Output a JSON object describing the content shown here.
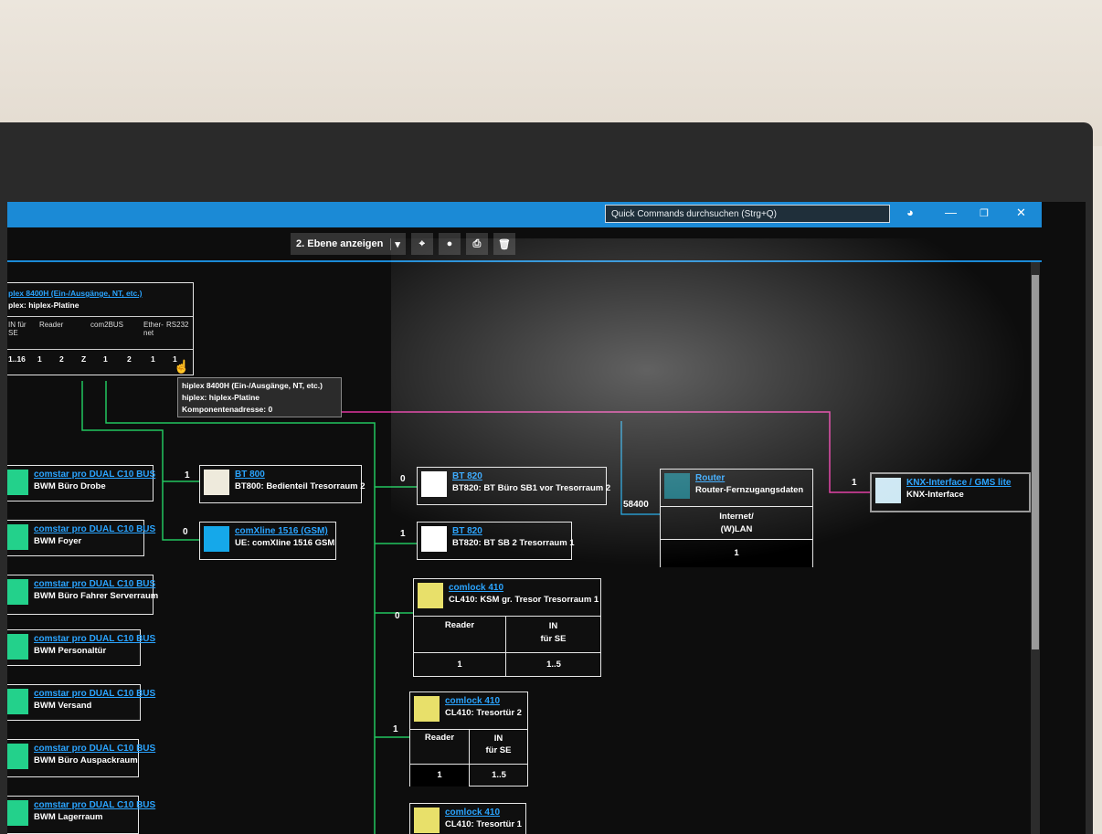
{
  "titlebar": {
    "search_placeholder": "Quick Commands durchsuchen (Strg+Q)",
    "icons": [
      "palette-icon",
      "minimize-icon",
      "restore-icon",
      "close-icon"
    ]
  },
  "toolbar": {
    "show_level_label": "2. Ebene anzeigen",
    "icons": [
      "dropdown-icon",
      "locate-icon",
      "pin-icon",
      "print-icon",
      "delete-icon"
    ]
  },
  "main_node": {
    "title": "plex 8400H (Ein-/Ausgänge, NT, etc.)",
    "subtitle": "plex: hiplex-Platine",
    "headers": [
      "IN für SE",
      "Reader",
      "com2BUS",
      "Ether-net",
      "RS232"
    ],
    "ports": [
      "1..16",
      "1",
      "2",
      "Z",
      "1",
      "2",
      "1",
      "1"
    ]
  },
  "tooltip": {
    "line1": "hiplex 8400H (Ein-/Ausgänge, NT, etc.)",
    "line2": "hiplex: hiplex-Platine",
    "line3": "Komponentenadresse: 0"
  },
  "left_nodes": [
    {
      "title": "comstar pro DUAL C10 BUS",
      "sub": "BWM Büro Drobe"
    },
    {
      "title": "comstar pro DUAL C10 BUS",
      "sub": "BWM Foyer"
    },
    {
      "title": "comstar pro DUAL C10 BUS",
      "sub": "BWM Büro Fahrer Serverraum"
    },
    {
      "title": "comstar pro DUAL C10 BUS",
      "sub": "BWM Personaltür"
    },
    {
      "title": "comstar pro DUAL C10 BUS",
      "sub": "BWM Versand"
    },
    {
      "title": "comstar pro DUAL C10 BUS",
      "sub": "BWM Büro Auspackraum"
    },
    {
      "title": "comstar pro DUAL C10 BUS",
      "sub": "BWM Lagerraum"
    }
  ],
  "bt800": {
    "addr": "1",
    "title": "BT 800",
    "sub": "BT800: Bedienteil Tresorraum 2"
  },
  "comxline": {
    "addr": "0",
    "title": "comXline 1516 (GSM)",
    "sub": "UE: comXline 1516 GSM"
  },
  "bt820a": {
    "addr": "0",
    "title": "BT 820",
    "sub": "BT820: BT Büro SB1 vor Tresorraum 2"
  },
  "bt820b": {
    "addr": "1",
    "title": "BT 820",
    "sub": "BT820: BT SB 2 Tresorraum 1"
  },
  "comlock1": {
    "addr": "0",
    "title": "comlock 410",
    "sub": "CL410: KSM gr. Tresor Tresorraum 1",
    "h1": "Reader",
    "h2": "IN",
    "h2b": "für SE",
    "v1": "1",
    "v2": "1..5"
  },
  "comlock2": {
    "addr": "1",
    "title": "comlock 410",
    "sub": "CL410: Tresortür 2",
    "h1": "Reader",
    "h2": "IN",
    "h2b": "für SE",
    "v1": "1",
    "v2": "1..5"
  },
  "comlock3": {
    "title": "comlock 410",
    "sub": "CL410: Tresortür 1"
  },
  "router": {
    "port": "58400",
    "title": "Router",
    "sub": "Router-Fernzugangsdaten",
    "iface1": "Internet/",
    "iface2": "(W)LAN",
    "val": "1"
  },
  "knx": {
    "addr": "1",
    "title": "KNX-Interface / GMS lite",
    "sub": "KNX-Interface"
  },
  "colors": {
    "accent": "#1b8ad6",
    "green": "#22c55e",
    "magenta": "#e0359f",
    "cyan": "#15a8ea",
    "yellow": "#e8e06a",
    "cream": "#eeeadc",
    "teal": "#0f6b78",
    "lightblue": "#cde7f3",
    "mint": "#23d18b"
  }
}
